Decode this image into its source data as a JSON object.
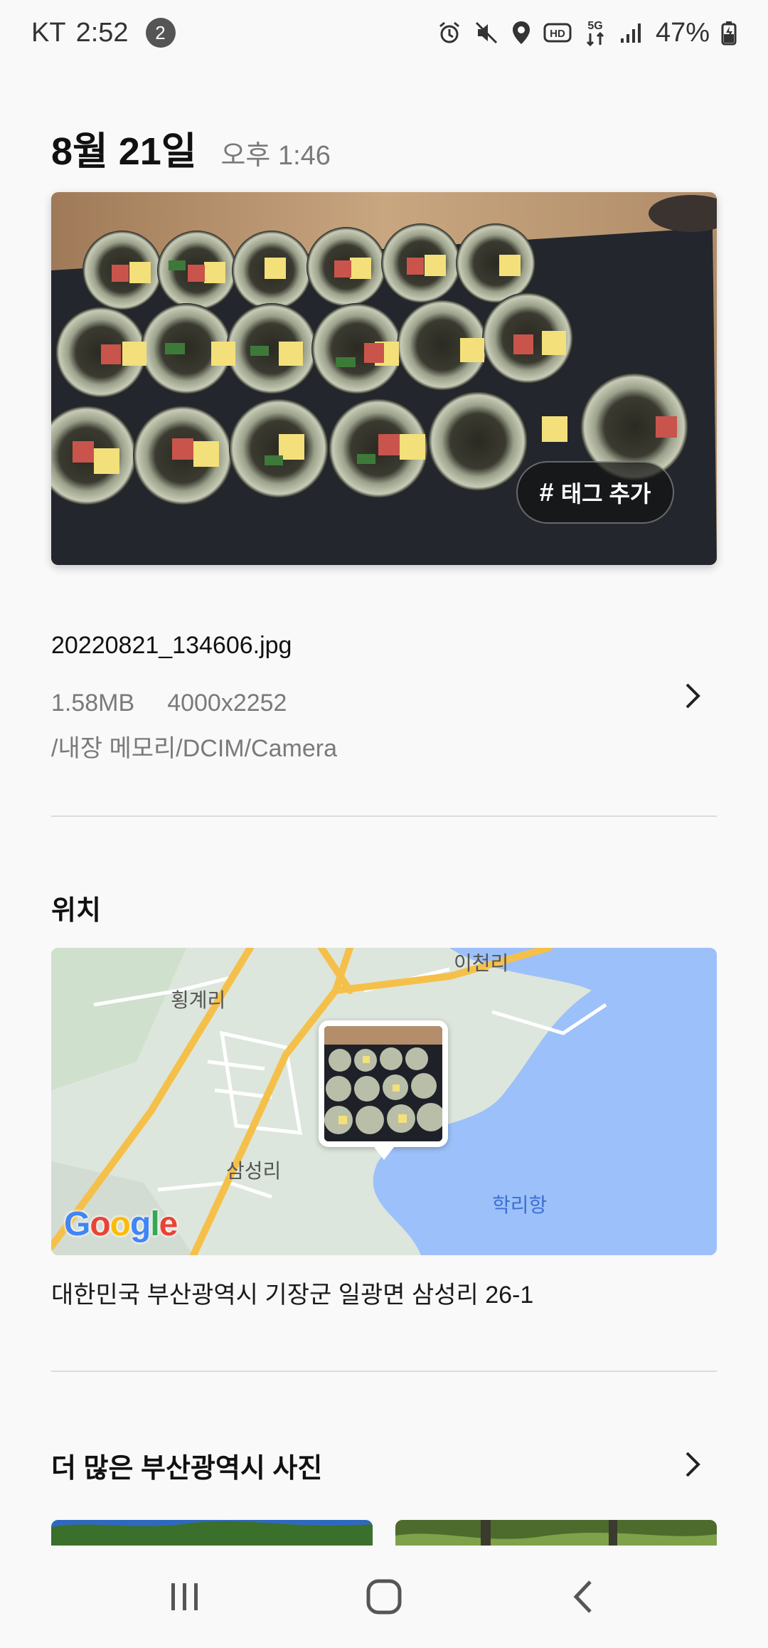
{
  "status_bar": {
    "carrier": "KT",
    "time": "2:52",
    "notification_count": "2",
    "battery_percent": "47%",
    "icons": [
      "alarm-icon",
      "mute-icon",
      "location-icon",
      "hd-icon",
      "5g-icon",
      "signal-icon",
      "battery-icon"
    ]
  },
  "header": {
    "date": "8월 21일",
    "time": "오후 1:46"
  },
  "photo": {
    "tag_button_label": "태그 추가",
    "tag_icon": "#"
  },
  "file": {
    "name": "20220821_134606.jpg",
    "size": "1.58MB",
    "resolution": "4000x2252",
    "path": "/내장 메모리/DCIM/Camera"
  },
  "location": {
    "title": "위치",
    "map_labels": {
      "north": "이천리",
      "west": "횡계리",
      "center": "삼성리",
      "port": "학리항"
    },
    "map_provider": "Google",
    "address": "대한민국 부산광역시 기장군 일광면 삼성리 26-1"
  },
  "more": {
    "title": "더 많은 부산광역시 사진"
  },
  "nav": {
    "recent_icon": "recent-apps-icon",
    "home_icon": "home-icon",
    "back_icon": "back-icon"
  },
  "colors": {
    "background": "#f9f9f9",
    "map_water": "#9cc0f9",
    "map_land": "#dde6dc",
    "map_road": "#f5c04a"
  }
}
